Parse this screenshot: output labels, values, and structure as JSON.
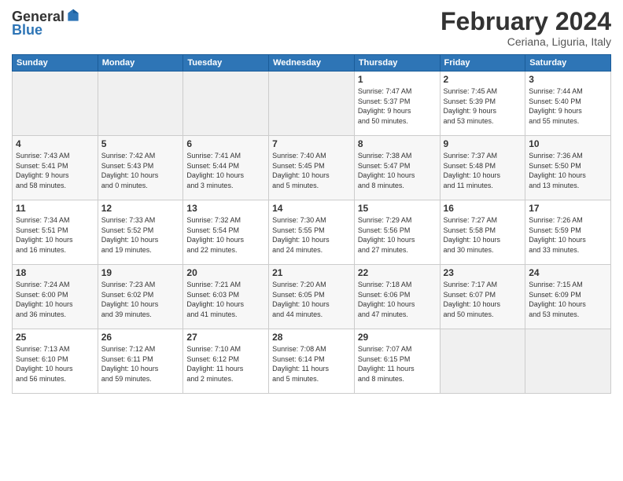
{
  "header": {
    "logo_general": "General",
    "logo_blue": "Blue",
    "month_title": "February 2024",
    "location": "Ceriana, Liguria, Italy"
  },
  "weekdays": [
    "Sunday",
    "Monday",
    "Tuesday",
    "Wednesday",
    "Thursday",
    "Friday",
    "Saturday"
  ],
  "weeks": [
    [
      {
        "day": "",
        "info": ""
      },
      {
        "day": "",
        "info": ""
      },
      {
        "day": "",
        "info": ""
      },
      {
        "day": "",
        "info": ""
      },
      {
        "day": "1",
        "info": "Sunrise: 7:47 AM\nSunset: 5:37 PM\nDaylight: 9 hours\nand 50 minutes."
      },
      {
        "day": "2",
        "info": "Sunrise: 7:45 AM\nSunset: 5:39 PM\nDaylight: 9 hours\nand 53 minutes."
      },
      {
        "day": "3",
        "info": "Sunrise: 7:44 AM\nSunset: 5:40 PM\nDaylight: 9 hours\nand 55 minutes."
      }
    ],
    [
      {
        "day": "4",
        "info": "Sunrise: 7:43 AM\nSunset: 5:41 PM\nDaylight: 9 hours\nand 58 minutes."
      },
      {
        "day": "5",
        "info": "Sunrise: 7:42 AM\nSunset: 5:43 PM\nDaylight: 10 hours\nand 0 minutes."
      },
      {
        "day": "6",
        "info": "Sunrise: 7:41 AM\nSunset: 5:44 PM\nDaylight: 10 hours\nand 3 minutes."
      },
      {
        "day": "7",
        "info": "Sunrise: 7:40 AM\nSunset: 5:45 PM\nDaylight: 10 hours\nand 5 minutes."
      },
      {
        "day": "8",
        "info": "Sunrise: 7:38 AM\nSunset: 5:47 PM\nDaylight: 10 hours\nand 8 minutes."
      },
      {
        "day": "9",
        "info": "Sunrise: 7:37 AM\nSunset: 5:48 PM\nDaylight: 10 hours\nand 11 minutes."
      },
      {
        "day": "10",
        "info": "Sunrise: 7:36 AM\nSunset: 5:50 PM\nDaylight: 10 hours\nand 13 minutes."
      }
    ],
    [
      {
        "day": "11",
        "info": "Sunrise: 7:34 AM\nSunset: 5:51 PM\nDaylight: 10 hours\nand 16 minutes."
      },
      {
        "day": "12",
        "info": "Sunrise: 7:33 AM\nSunset: 5:52 PM\nDaylight: 10 hours\nand 19 minutes."
      },
      {
        "day": "13",
        "info": "Sunrise: 7:32 AM\nSunset: 5:54 PM\nDaylight: 10 hours\nand 22 minutes."
      },
      {
        "day": "14",
        "info": "Sunrise: 7:30 AM\nSunset: 5:55 PM\nDaylight: 10 hours\nand 24 minutes."
      },
      {
        "day": "15",
        "info": "Sunrise: 7:29 AM\nSunset: 5:56 PM\nDaylight: 10 hours\nand 27 minutes."
      },
      {
        "day": "16",
        "info": "Sunrise: 7:27 AM\nSunset: 5:58 PM\nDaylight: 10 hours\nand 30 minutes."
      },
      {
        "day": "17",
        "info": "Sunrise: 7:26 AM\nSunset: 5:59 PM\nDaylight: 10 hours\nand 33 minutes."
      }
    ],
    [
      {
        "day": "18",
        "info": "Sunrise: 7:24 AM\nSunset: 6:00 PM\nDaylight: 10 hours\nand 36 minutes."
      },
      {
        "day": "19",
        "info": "Sunrise: 7:23 AM\nSunset: 6:02 PM\nDaylight: 10 hours\nand 39 minutes."
      },
      {
        "day": "20",
        "info": "Sunrise: 7:21 AM\nSunset: 6:03 PM\nDaylight: 10 hours\nand 41 minutes."
      },
      {
        "day": "21",
        "info": "Sunrise: 7:20 AM\nSunset: 6:05 PM\nDaylight: 10 hours\nand 44 minutes."
      },
      {
        "day": "22",
        "info": "Sunrise: 7:18 AM\nSunset: 6:06 PM\nDaylight: 10 hours\nand 47 minutes."
      },
      {
        "day": "23",
        "info": "Sunrise: 7:17 AM\nSunset: 6:07 PM\nDaylight: 10 hours\nand 50 minutes."
      },
      {
        "day": "24",
        "info": "Sunrise: 7:15 AM\nSunset: 6:09 PM\nDaylight: 10 hours\nand 53 minutes."
      }
    ],
    [
      {
        "day": "25",
        "info": "Sunrise: 7:13 AM\nSunset: 6:10 PM\nDaylight: 10 hours\nand 56 minutes."
      },
      {
        "day": "26",
        "info": "Sunrise: 7:12 AM\nSunset: 6:11 PM\nDaylight: 10 hours\nand 59 minutes."
      },
      {
        "day": "27",
        "info": "Sunrise: 7:10 AM\nSunset: 6:12 PM\nDaylight: 11 hours\nand 2 minutes."
      },
      {
        "day": "28",
        "info": "Sunrise: 7:08 AM\nSunset: 6:14 PM\nDaylight: 11 hours\nand 5 minutes."
      },
      {
        "day": "29",
        "info": "Sunrise: 7:07 AM\nSunset: 6:15 PM\nDaylight: 11 hours\nand 8 minutes."
      },
      {
        "day": "",
        "info": ""
      },
      {
        "day": "",
        "info": ""
      }
    ]
  ]
}
